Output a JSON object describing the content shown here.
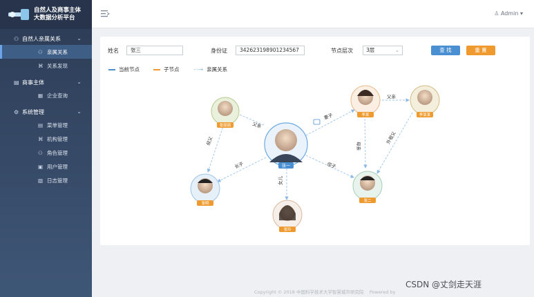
{
  "brand": {
    "line1": "自然人及商事主体",
    "line2": "大数据分析平台"
  },
  "sidebar": {
    "group1": "自然人亲属关系",
    "g1_items": [
      "亲属关系",
      "关系发现"
    ],
    "group2": "商事主体",
    "g2_items": [
      "企业查询"
    ],
    "group3": "系统管理",
    "g3_items": [
      "菜单管理",
      "机构管理",
      "角色管理",
      "用户管理",
      "日志管理"
    ]
  },
  "topbar": {
    "user": "Admin"
  },
  "search": {
    "name_label": "姓名",
    "name_value": "张三",
    "id_label": "身份证",
    "id_value": "342623198901234567",
    "level_label": "节点层次",
    "level_value": "3层",
    "search_btn": "查 找",
    "reset_btn": "重 置"
  },
  "legend": {
    "current": "当前节点",
    "child": "子节点",
    "relation": "亲属关系"
  },
  "colors": {
    "blue": "#4b8fd3",
    "orange": "#ee9a2e",
    "sidebar": "#2c3b55"
  },
  "graph": {
    "nodes": [
      "张一",
      "张三",
      "张丽丽",
      "李某",
      "张明",
      "张二",
      "张玲",
      "李某某"
    ],
    "edges": [
      "父亲",
      "妻子",
      "父亲",
      "母亲",
      "外祖父",
      "叔父",
      "侄子",
      "长子",
      "女儿"
    ]
  },
  "footer": {
    "copyright": "Copyright © 2018 中国科学技术大学智慧城市研究院",
    "powered": "Powered by"
  },
  "watermark": "CSDN @丈剑走天涯"
}
